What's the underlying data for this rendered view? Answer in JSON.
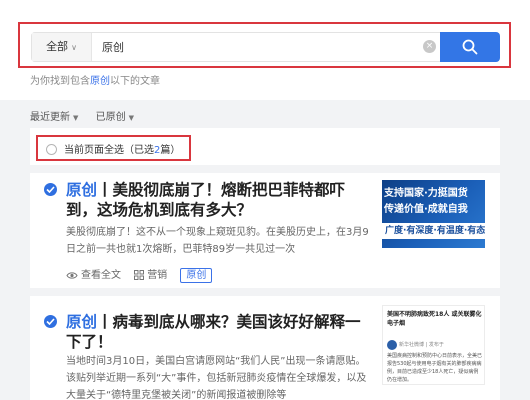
{
  "search": {
    "scope_label": "全部",
    "query": "原创"
  },
  "result_hint": {
    "prefix": "为你找到包含",
    "keyword": "原创",
    "suffix": "以下的文章"
  },
  "filters": {
    "sort_label": "最近更新",
    "type_label": "已原创"
  },
  "select_all": {
    "label": "当前页面全选（已选",
    "count": "2",
    "suffix": "篇）"
  },
  "articles": [
    {
      "tag": "原创",
      "separator": "丨",
      "title": "美股彻底崩了！熔断把巴菲特都吓到，这场危机到底有多大？",
      "excerpt": "美股彻底崩了！这不从一个现象上窥斑见豹。在美股历史上，在3月9日之前一共也就1次熔断，巴菲特89岁一共见过一次",
      "view_label": "查看全文",
      "category": "营销",
      "badge": "原创",
      "thumb_line1": "支持国家·力挺国货",
      "thumb_line2": "传递价值·成就自我",
      "thumb_line3": "广度·有深度·有温度·有态度"
    },
    {
      "tag": "原创",
      "separator": "丨",
      "title": "病毒到底从哪来？美国该好好解释一下了！",
      "excerpt": "当地时间3月10日，美国白宫请愿网站“我们人民”出现一条请愿贴。该贴列举近期一系列“大”事件，包括新冠肺炎疫情在全球爆发，以及大量关于“德特里克堡被关闭”的新闻报道被删除等",
      "thumb_headline": "美国不明肺病致死18人 或关联雾化电子烟",
      "thumb_source": "新华社微博 | 发布于",
      "thumb_body": "美国疾病控制和预防中心日前表示，全美已报告530起与使用电子烟有关的肺部疾病病例，目前已造成至少18人死亡，疑似病例仍在增加。"
    }
  ],
  "colors": {
    "accent": "#3376e6",
    "highlight_outline": "#d9363e",
    "link": "#3b72e8"
  }
}
